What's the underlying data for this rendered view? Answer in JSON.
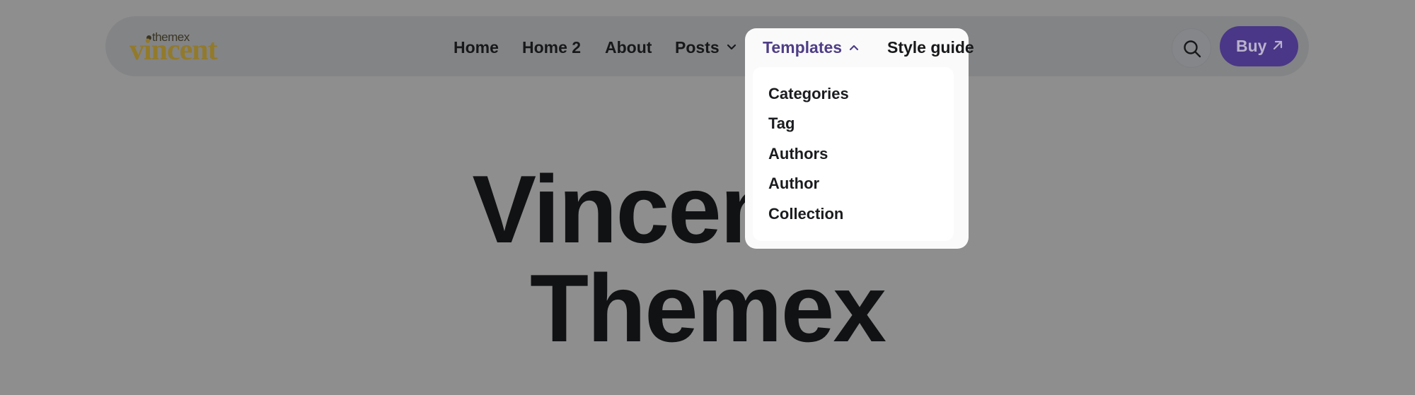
{
  "logo": {
    "top_text": "themex",
    "main_text": "vincent"
  },
  "nav": {
    "home": "Home",
    "home2": "Home 2",
    "about": "About",
    "posts": "Posts",
    "templates": "Templates",
    "style_guide": "Style guide"
  },
  "templates_menu": {
    "items": [
      "Categories",
      "Tag",
      "Authors",
      "Author",
      "Collection"
    ]
  },
  "actions": {
    "search_icon": "search-icon",
    "buy_label": "Buy",
    "buy_icon": "arrow-up-right-icon"
  },
  "hero": {
    "line1": "Vincent de",
    "line2": "Themex"
  },
  "colors": {
    "accent_purple": "#4a3787",
    "templates_active": "#4f3e87",
    "logo_gold": "#927a2c",
    "overlay_gray": "#8e8e8e"
  }
}
